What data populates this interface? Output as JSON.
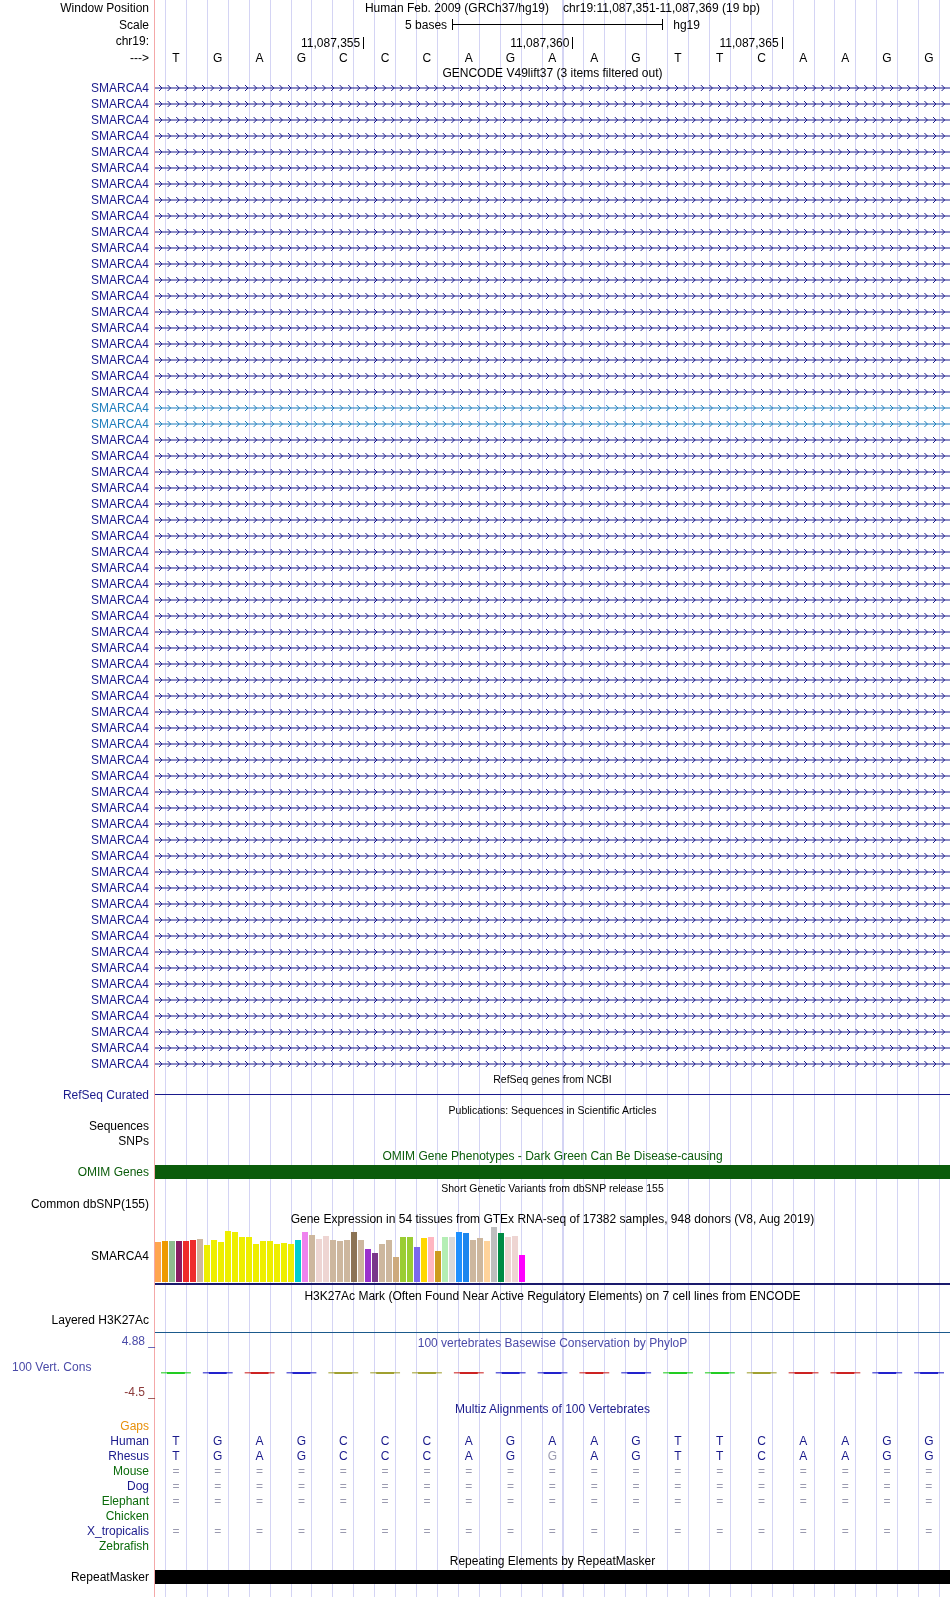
{
  "position_row": {
    "label": "Window Position",
    "assembly_title": "Human Feb. 2009 (GRCh37/hg19)",
    "range": "chr19:11,087,351-11,087,369 (19 bp)"
  },
  "scale_row": {
    "label": "Scale",
    "span": "5 bases",
    "database": "hg19"
  },
  "coordinate_row": {
    "label": "chr19:",
    "ticks": [
      "11,087,355",
      "11,087,360",
      "11,087,365"
    ]
  },
  "sequence_row": {
    "label": "--->",
    "bases": [
      "T",
      "G",
      "A",
      "G",
      "C",
      "C",
      "C",
      "A",
      "G",
      "A",
      "A",
      "G",
      "T",
      "T",
      "C",
      "A",
      "A",
      "G",
      "G"
    ]
  },
  "tracks": [
    {
      "kind": "genes",
      "title": "GENCODE V49lift37 (3 items filtered out)",
      "rows": [
        {
          "label": "SMARCA4",
          "color": "#1a1a8c"
        },
        {
          "label": "SMARCA4",
          "color": "#1a1a8c"
        },
        {
          "label": "SMARCA4",
          "color": "#1a1a8c"
        },
        {
          "label": "SMARCA4",
          "color": "#1a1a8c"
        },
        {
          "label": "SMARCA4",
          "color": "#1a1a8c"
        },
        {
          "label": "SMARCA4",
          "color": "#1a1a8c"
        },
        {
          "label": "SMARCA4",
          "color": "#1a1a8c"
        },
        {
          "label": "SMARCA4",
          "color": "#1a1a8c"
        },
        {
          "label": "SMARCA4",
          "color": "#1a1a8c"
        },
        {
          "label": "SMARCA4",
          "color": "#1a1a8c"
        },
        {
          "label": "SMARCA4",
          "color": "#1a1a8c"
        },
        {
          "label": "SMARCA4",
          "color": "#1a1a8c"
        },
        {
          "label": "SMARCA4",
          "color": "#1a1a8c"
        },
        {
          "label": "SMARCA4",
          "color": "#1a1a8c"
        },
        {
          "label": "SMARCA4",
          "color": "#1a1a8c"
        },
        {
          "label": "SMARCA4",
          "color": "#1a1a8c"
        },
        {
          "label": "SMARCA4",
          "color": "#1a1a8c"
        },
        {
          "label": "SMARCA4",
          "color": "#1a1a8c"
        },
        {
          "label": "SMARCA4",
          "color": "#1a1a8c"
        },
        {
          "label": "SMARCA4",
          "color": "#1a1a8c"
        },
        {
          "label": "SMARCA4",
          "color": "#1f7dbd"
        },
        {
          "label": "SMARCA4",
          "color": "#1f7dbd"
        },
        {
          "label": "SMARCA4",
          "color": "#1a1a8c"
        },
        {
          "label": "SMARCA4",
          "color": "#1a1a8c"
        },
        {
          "label": "SMARCA4",
          "color": "#1a1a8c"
        },
        {
          "label": "SMARCA4",
          "color": "#1a1a8c"
        },
        {
          "label": "SMARCA4",
          "color": "#1a1a8c"
        },
        {
          "label": "SMARCA4",
          "color": "#1a1a8c"
        },
        {
          "label": "SMARCA4",
          "color": "#1a1a8c"
        },
        {
          "label": "SMARCA4",
          "color": "#1a1a8c"
        },
        {
          "label": "SMARCA4",
          "color": "#1a1a8c"
        },
        {
          "label": "SMARCA4",
          "color": "#1a1a8c"
        },
        {
          "label": "SMARCA4",
          "color": "#1a1a8c"
        },
        {
          "label": "SMARCA4",
          "color": "#1a1a8c"
        },
        {
          "label": "SMARCA4",
          "color": "#1a1a8c"
        },
        {
          "label": "SMARCA4",
          "color": "#1a1a8c"
        },
        {
          "label": "SMARCA4",
          "color": "#1a1a8c"
        },
        {
          "label": "SMARCA4",
          "color": "#1a1a8c"
        },
        {
          "label": "SMARCA4",
          "color": "#1a1a8c"
        },
        {
          "label": "SMARCA4",
          "color": "#1a1a8c"
        },
        {
          "label": "SMARCA4",
          "color": "#1a1a8c"
        },
        {
          "label": "SMARCA4",
          "color": "#1a1a8c"
        },
        {
          "label": "SMARCA4",
          "color": "#1a1a8c"
        },
        {
          "label": "SMARCA4",
          "color": "#1a1a8c"
        },
        {
          "label": "SMARCA4",
          "color": "#1a1a8c"
        },
        {
          "label": "SMARCA4",
          "color": "#1a1a8c"
        },
        {
          "label": "SMARCA4",
          "color": "#1a1a8c"
        },
        {
          "label": "SMARCA4",
          "color": "#1a1a8c"
        },
        {
          "label": "SMARCA4",
          "color": "#1a1a8c"
        },
        {
          "label": "SMARCA4",
          "color": "#1a1a8c"
        },
        {
          "label": "SMARCA4",
          "color": "#1a1a8c"
        },
        {
          "label": "SMARCA4",
          "color": "#1a1a8c"
        },
        {
          "label": "SMARCA4",
          "color": "#1a1a8c"
        },
        {
          "label": "SMARCA4",
          "color": "#1a1a8c"
        },
        {
          "label": "SMARCA4",
          "color": "#1a1a8c"
        },
        {
          "label": "SMARCA4",
          "color": "#1a1a8c"
        },
        {
          "label": "SMARCA4",
          "color": "#1a1a8c"
        },
        {
          "label": "SMARCA4",
          "color": "#1a1a8c"
        },
        {
          "label": "SMARCA4",
          "color": "#1a1a8c"
        },
        {
          "label": "SMARCA4",
          "color": "#1a1a8c"
        },
        {
          "label": "SMARCA4",
          "color": "#1a1a8c"
        },
        {
          "label": "SMARCA4",
          "color": "#1a1a8c"
        }
      ]
    },
    {
      "kind": "line",
      "title": "RefSeq genes from NCBI",
      "label": "RefSeq Curated",
      "color": "#1a1a8c"
    },
    {
      "kind": "labels",
      "title": "Publications: Sequences in Scientific Articles",
      "labels": [
        "Sequences",
        "SNPs"
      ]
    },
    {
      "kind": "bar",
      "title": "OMIM Gene Phenotypes - Dark Green Can Be Disease-causing",
      "label": "OMIM Genes",
      "color": "#0b5c0b"
    },
    {
      "kind": "labels",
      "title": "Short Genetic Variants from dbSNP release 155",
      "labels": [
        "Common dbSNP(155)"
      ]
    },
    {
      "kind": "expression",
      "title": "Gene Expression in 54 tissues from GTEx RNA-seq of 17382 samples, 948 donors (V8, Aug 2019)",
      "label": "SMARCA4"
    },
    {
      "kind": "layered",
      "title": "H3K27Ac Mark (Often Found Near Active Regulatory Elements) on 7 cell lines from ENCODE",
      "label": "Layered H3K27Ac"
    },
    {
      "kind": "wiggle",
      "title": "100 vertebrates Basewise Conservation by PhyloP",
      "max": "4.88 _",
      "label": "100 Vert. Cons",
      "min": "-4.5 _"
    },
    {
      "kind": "alignment",
      "title": "Multiz Alignments of 100 Vertebrates",
      "species": [
        {
          "name": "Gaps",
          "color": "#e8900a"
        },
        {
          "name": "Human",
          "color": "#1a1a8c",
          "bases": [
            {
              "base": "T",
              "dim": false
            },
            {
              "base": "G",
              "dim": false
            },
            {
              "base": "A",
              "dim": false
            },
            {
              "base": "G",
              "dim": false
            },
            {
              "base": "C",
              "dim": false
            },
            {
              "base": "C",
              "dim": false
            },
            {
              "base": "C",
              "dim": false
            },
            {
              "base": "A",
              "dim": false
            },
            {
              "base": "G",
              "dim": false
            },
            {
              "base": "A",
              "dim": false
            },
            {
              "base": "A",
              "dim": false
            },
            {
              "base": "G",
              "dim": false
            },
            {
              "base": "T",
              "dim": false
            },
            {
              "base": "T",
              "dim": false
            },
            {
              "base": "C",
              "dim": false
            },
            {
              "base": "A",
              "dim": false
            },
            {
              "base": "A",
              "dim": false
            },
            {
              "base": "G",
              "dim": false
            },
            {
              "base": "G",
              "dim": false
            }
          ]
        },
        {
          "name": "Rhesus",
          "color": "#1a1a8c",
          "bases": [
            {
              "base": "T",
              "dim": false
            },
            {
              "base": "G",
              "dim": false
            },
            {
              "base": "A",
              "dim": false
            },
            {
              "base": "G",
              "dim": false
            },
            {
              "base": "C",
              "dim": false
            },
            {
              "base": "C",
              "dim": false
            },
            {
              "base": "C",
              "dim": false
            },
            {
              "base": "A",
              "dim": false
            },
            {
              "base": "G",
              "dim": false
            },
            {
              "base": "G",
              "dim": true
            },
            {
              "base": "A",
              "dim": false
            },
            {
              "base": "G",
              "dim": false
            },
            {
              "base": "T",
              "dim": false
            },
            {
              "base": "T",
              "dim": false
            },
            {
              "base": "C",
              "dim": false
            },
            {
              "base": "A",
              "dim": false
            },
            {
              "base": "A",
              "dim": false
            },
            {
              "base": "G",
              "dim": false
            },
            {
              "base": "G",
              "dim": false
            }
          ]
        },
        {
          "name": "Mouse",
          "color": "#0b6b0b",
          "bases": [
            {
              "base": "=",
              "dim": true
            },
            {
              "base": "=",
              "dim": true
            },
            {
              "base": "=",
              "dim": true
            },
            {
              "base": "=",
              "dim": true
            },
            {
              "base": "=",
              "dim": true
            },
            {
              "base": "=",
              "dim": true
            },
            {
              "base": "=",
              "dim": true
            },
            {
              "base": "=",
              "dim": true
            },
            {
              "base": "=",
              "dim": true
            },
            {
              "base": "=",
              "dim": true
            },
            {
              "base": "=",
              "dim": true
            },
            {
              "base": "=",
              "dim": true
            },
            {
              "base": "=",
              "dim": true
            },
            {
              "base": "=",
              "dim": true
            },
            {
              "base": "=",
              "dim": true
            },
            {
              "base": "=",
              "dim": true
            },
            {
              "base": "=",
              "dim": true
            },
            {
              "base": "=",
              "dim": true
            },
            {
              "base": "=",
              "dim": true
            }
          ]
        },
        {
          "name": "Dog",
          "color": "#1a1a8c",
          "bases": [
            {
              "base": "=",
              "dim": true
            },
            {
              "base": "=",
              "dim": true
            },
            {
              "base": "=",
              "dim": true
            },
            {
              "base": "=",
              "dim": true
            },
            {
              "base": "=",
              "dim": true
            },
            {
              "base": "=",
              "dim": true
            },
            {
              "base": "=",
              "dim": true
            },
            {
              "base": "=",
              "dim": true
            },
            {
              "base": "=",
              "dim": true
            },
            {
              "base": "=",
              "dim": true
            },
            {
              "base": "=",
              "dim": true
            },
            {
              "base": "=",
              "dim": true
            },
            {
              "base": "=",
              "dim": true
            },
            {
              "base": "=",
              "dim": true
            },
            {
              "base": "=",
              "dim": true
            },
            {
              "base": "=",
              "dim": true
            },
            {
              "base": "=",
              "dim": true
            },
            {
              "base": "=",
              "dim": true
            },
            {
              "base": "=",
              "dim": true
            }
          ]
        },
        {
          "name": "Elephant",
          "color": "#0b6b0b",
          "bases": [
            {
              "base": "=",
              "dim": true
            },
            {
              "base": "=",
              "dim": true
            },
            {
              "base": "=",
              "dim": true
            },
            {
              "base": "=",
              "dim": true
            },
            {
              "base": "=",
              "dim": true
            },
            {
              "base": "=",
              "dim": true
            },
            {
              "base": "=",
              "dim": true
            },
            {
              "base": "=",
              "dim": true
            },
            {
              "base": "=",
              "dim": true
            },
            {
              "base": "=",
              "dim": true
            },
            {
              "base": "=",
              "dim": true
            },
            {
              "base": "=",
              "dim": true
            },
            {
              "base": "=",
              "dim": true
            },
            {
              "base": "=",
              "dim": true
            },
            {
              "base": "=",
              "dim": true
            },
            {
              "base": "=",
              "dim": true
            },
            {
              "base": "=",
              "dim": true
            },
            {
              "base": "=",
              "dim": true
            },
            {
              "base": "=",
              "dim": true
            }
          ]
        },
        {
          "name": "Chicken",
          "color": "#0b6b0b"
        },
        {
          "name": "X_tropicalis",
          "color": "#1a1a8c",
          "bases": [
            {
              "base": "=",
              "dim": true
            },
            {
              "base": "=",
              "dim": true
            },
            {
              "base": "=",
              "dim": true
            },
            {
              "base": "=",
              "dim": true
            },
            {
              "base": "=",
              "dim": true
            },
            {
              "base": "=",
              "dim": true
            },
            {
              "base": "=",
              "dim": true
            },
            {
              "base": "=",
              "dim": true
            },
            {
              "base": "=",
              "dim": true
            },
            {
              "base": "=",
              "dim": true
            },
            {
              "base": "=",
              "dim": true
            },
            {
              "base": "=",
              "dim": true
            },
            {
              "base": "=",
              "dim": true
            },
            {
              "base": "=",
              "dim": true
            },
            {
              "base": "=",
              "dim": true
            },
            {
              "base": "=",
              "dim": true
            },
            {
              "base": "=",
              "dim": true
            },
            {
              "base": "=",
              "dim": true
            },
            {
              "base": "=",
              "dim": true
            }
          ]
        },
        {
          "name": "Zebrafish",
          "color": "#0b6b0b"
        }
      ]
    },
    {
      "kind": "bar",
      "title": "Repeating Elements by RepeatMasker",
      "label": "RepeatMasker",
      "color": "#000000"
    }
  ]
}
